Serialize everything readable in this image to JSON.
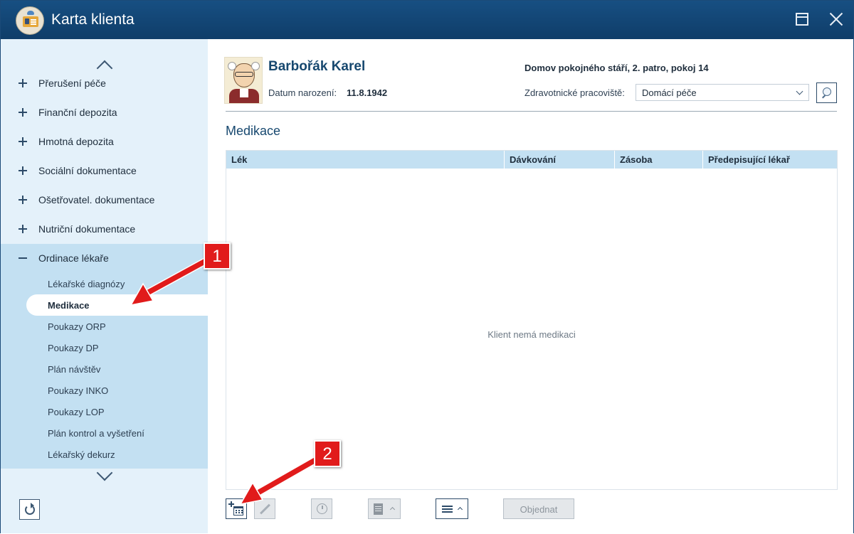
{
  "window": {
    "title": "Karta klienta"
  },
  "sidebar": {
    "items": [
      {
        "label": "Přerušení péče"
      },
      {
        "label": "Finanční depozita"
      },
      {
        "label": "Hmotná depozita"
      },
      {
        "label": "Sociální dokumentace"
      },
      {
        "label": "Ošetřovatel. dokumentace"
      },
      {
        "label": "Nutriční dokumentace"
      }
    ],
    "expanded": {
      "label": "Ordinace lékaře",
      "children": [
        {
          "label": "Lékařské diagnózy"
        },
        {
          "label": "Medikace",
          "active": true
        },
        {
          "label": "Poukazy ORP"
        },
        {
          "label": "Poukazy DP"
        },
        {
          "label": "Plán návštěv"
        },
        {
          "label": "Poukazy INKO"
        },
        {
          "label": "Poukazy LOP"
        },
        {
          "label": "Plán kontrol a vyšetření"
        },
        {
          "label": "Lékařský dekurz"
        }
      ]
    }
  },
  "client": {
    "name": "Barbořák Karel",
    "dob_label": "Datum narození:",
    "dob": "11.8.1942",
    "location": "Domov pokojného stáří, 2. patro, pokoj 14",
    "workplace_label": "Zdravotnické pracoviště:",
    "workplace_value": "Domácí péče"
  },
  "section": {
    "title": "Medikace"
  },
  "table": {
    "columns": [
      "Lék",
      "Dávkování",
      "Zásoba",
      "Předepisující lékař"
    ],
    "empty_message": "Klient nemá medikaci"
  },
  "toolbar": {
    "order_label": "Objednat"
  },
  "callouts": [
    "1",
    "2"
  ],
  "colors": {
    "titlebar": "#174f82",
    "sidebar_bg": "#e4f1fa",
    "sidebar_expanded_bg": "#c3e0f2",
    "accent_text": "#17486f",
    "callout": "#e11b1b"
  }
}
